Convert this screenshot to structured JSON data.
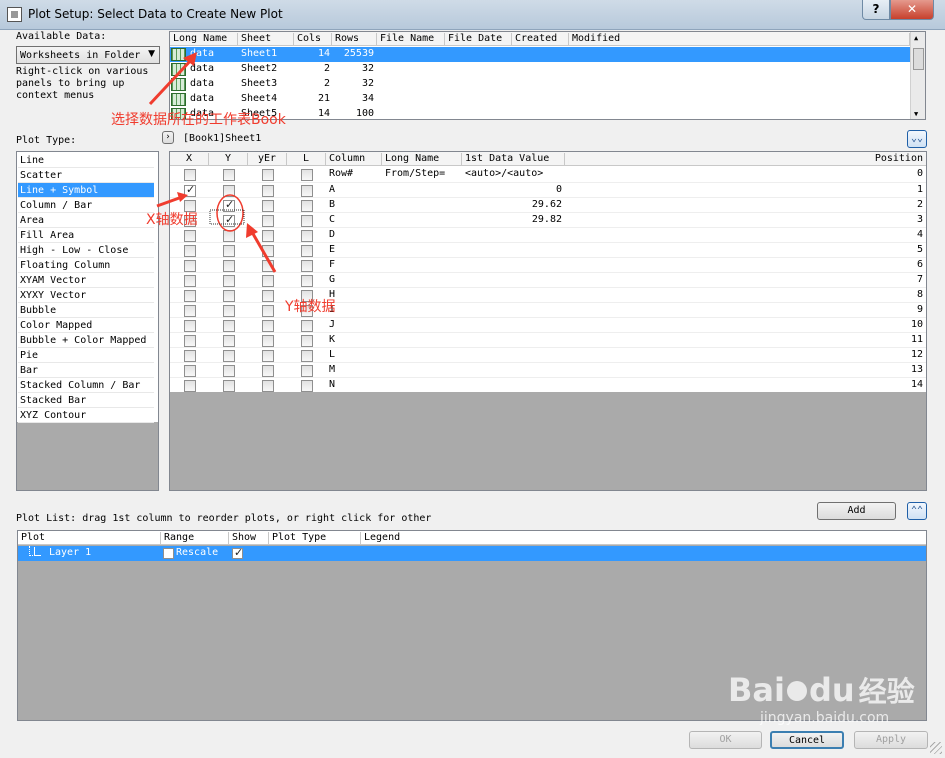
{
  "window": {
    "title": "Plot Setup: Select Data to Create New Plot",
    "help": "?",
    "close": "✕"
  },
  "available": {
    "label": "Available Data:",
    "dropdown": "Worksheets in Folder",
    "hint_lines": [
      "Right-click on various",
      "panels to bring up",
      "context menus"
    ]
  },
  "sheets": {
    "columns": [
      "Long Name",
      "Sheet",
      "Cols",
      "Rows",
      "File Name",
      "File Date",
      "Created",
      "Modified"
    ],
    "rows": [
      {
        "long": "data",
        "sheet": "Sheet1",
        "cols": "14",
        "rows": "25539"
      },
      {
        "long": "data",
        "sheet": "Sheet2",
        "cols": "2",
        "rows": "32"
      },
      {
        "long": "data",
        "sheet": "Sheet3",
        "cols": "2",
        "rows": "32"
      },
      {
        "long": "data",
        "sheet": "Sheet4",
        "cols": "21",
        "rows": "34"
      },
      {
        "long": "data",
        "sheet": "Sheet5",
        "cols": "14",
        "rows": "100"
      }
    ]
  },
  "plot_type": {
    "label": "Plot Type:",
    "items": [
      "Line",
      "Scatter",
      "Line + Symbol",
      "Column / Bar",
      "Area",
      "Fill Area",
      "High - Low - Close",
      "Floating Column",
      "XYAM Vector",
      "XYXY Vector",
      "Bubble",
      "Color Mapped",
      "Bubble + Color Mapped",
      "Pie",
      "Bar",
      "Stacked Column / Bar",
      "Stacked Bar",
      "XYZ Contour"
    ],
    "selected": 2
  },
  "breadcrumb": "[Book1]Sheet1",
  "columns_grid": {
    "headers": [
      "X",
      "Y",
      "yEr",
      "L",
      "Column",
      "Long Name",
      "1st Data Value",
      "Position"
    ],
    "first_row": {
      "column": "Row#",
      "long": "From/Step=",
      "value": "<auto>/<auto>",
      "position": "0"
    },
    "rows": [
      {
        "column": "A",
        "value": "0",
        "position": "1",
        "x": true,
        "y": false
      },
      {
        "column": "B",
        "value": "29.62",
        "position": "2",
        "x": false,
        "y": true
      },
      {
        "column": "C",
        "value": "29.82",
        "position": "3",
        "x": false,
        "y": true
      },
      {
        "column": "D",
        "value": "",
        "position": "4",
        "x": false,
        "y": false
      },
      {
        "column": "E",
        "value": "",
        "position": "5",
        "x": false,
        "y": false
      },
      {
        "column": "F",
        "value": "",
        "position": "6",
        "x": false,
        "y": false
      },
      {
        "column": "G",
        "value": "",
        "position": "7",
        "x": false,
        "y": false
      },
      {
        "column": "H",
        "value": "",
        "position": "8",
        "x": false,
        "y": false
      },
      {
        "column": "I",
        "value": "",
        "position": "9",
        "x": false,
        "y": false
      },
      {
        "column": "J",
        "value": "",
        "position": "10",
        "x": false,
        "y": false
      },
      {
        "column": "K",
        "value": "",
        "position": "11",
        "x": false,
        "y": false
      },
      {
        "column": "L",
        "value": "",
        "position": "12",
        "x": false,
        "y": false
      },
      {
        "column": "M",
        "value": "",
        "position": "13",
        "x": false,
        "y": false
      },
      {
        "column": "N",
        "value": "",
        "position": "14",
        "x": false,
        "y": false
      }
    ]
  },
  "plot_list": {
    "label": "Plot List: drag 1st column to reorder plots, or right click for other",
    "add": "Add",
    "columns": [
      "Plot",
      "Range",
      "Show",
      "Plot Type",
      "Legend"
    ],
    "row": {
      "plot": "Layer 1",
      "range": "Rescale"
    }
  },
  "buttons": {
    "ok": "OK",
    "cancel": "Cancel",
    "apply": "Apply"
  },
  "annotations": {
    "book": "选择数据所在的工作表Book",
    "x": "X轴数据",
    "y": "Y轴数据"
  },
  "watermark": {
    "brand": "Bai",
    "brand2": "du",
    "cn": "经验",
    "url": "jingyan.baidu.com"
  },
  "colors": {
    "accent": "#3399ff",
    "annotation": "#f03c2e"
  }
}
